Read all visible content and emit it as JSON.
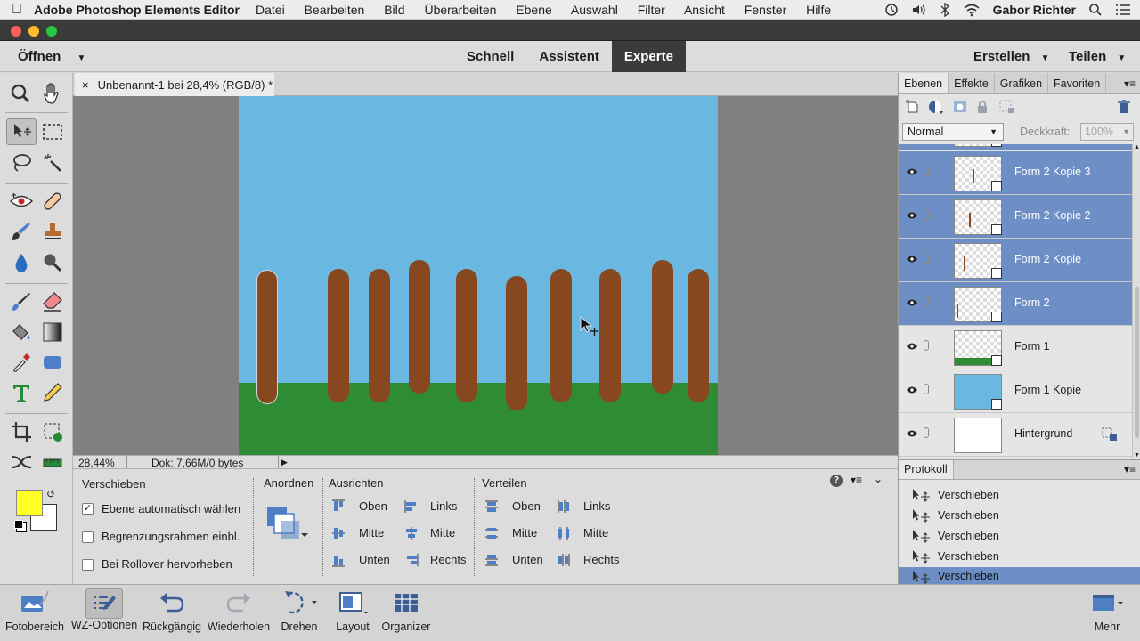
{
  "menubar": {
    "app_name": "Adobe Photoshop Elements Editor",
    "menus": [
      "Datei",
      "Bearbeiten",
      "Bild",
      "Überarbeiten",
      "Ebene",
      "Auswahl",
      "Filter",
      "Ansicht",
      "Fenster",
      "Hilfe"
    ],
    "user": "Gabor Richter"
  },
  "modebar": {
    "open_label": "Öffnen",
    "modes": [
      "Schnell",
      "Assistent",
      "Experte"
    ],
    "active_mode": "Experte",
    "create_label": "Erstellen",
    "share_label": "Teilen"
  },
  "document": {
    "tab_title": "Unbenannt-1 bei 28,4% (RGB/8) *",
    "zoom": "28,44%",
    "doc_info": "Dok: 7,66M/0 bytes"
  },
  "colors": {
    "foreground": "#ffff27",
    "background": "#ffffff",
    "sky": "#6ab7e2",
    "grass": "#2f8b34",
    "post": "#87471f",
    "selection": "#6e8fc5"
  },
  "tool_options": {
    "tool_name": "Verschieben",
    "checkbox_auto_select": "Ebene automatisch wählen",
    "checkbox_bounding": "Begrenzungsrahmen einbl.",
    "checkbox_rollover": "Bei Rollover hervorheben",
    "arrange_label": "Anordnen",
    "align_label": "Ausrichten",
    "align_items": [
      "Oben",
      "Mitte",
      "Unten",
      "Links",
      "Mitte",
      "Rechts"
    ],
    "distribute_label": "Verteilen",
    "distribute_items": [
      "Oben",
      "Mitte",
      "Unten",
      "Links",
      "Mitte",
      "Rechts"
    ]
  },
  "panel": {
    "tabs": [
      "Ebenen",
      "Effekte",
      "Grafiken",
      "Favoriten"
    ],
    "blend_mode": "Normal",
    "opacity_label": "Deckkraft:",
    "opacity_value": "100%",
    "layers": [
      {
        "name": "Form 2 Kopie 3",
        "selected": true
      },
      {
        "name": "Form 2 Kopie 2",
        "selected": true
      },
      {
        "name": "Form 2 Kopie",
        "selected": true
      },
      {
        "name": "Form 2",
        "selected": true
      },
      {
        "name": "Form 1",
        "selected": false
      },
      {
        "name": "Form 1 Kopie",
        "selected": false
      },
      {
        "name": "Hintergrund",
        "selected": false
      }
    ]
  },
  "history": {
    "title": "Protokoll",
    "items": [
      "Verschieben",
      "Verschieben",
      "Verschieben",
      "Verschieben",
      "Verschieben"
    ]
  },
  "bottombar": {
    "items": [
      "Fotobereich",
      "WZ-Optionen",
      "Rückgängig",
      "Wiederholen",
      "Drehen",
      "Layout",
      "Organizer"
    ],
    "more_label": "Mehr"
  }
}
